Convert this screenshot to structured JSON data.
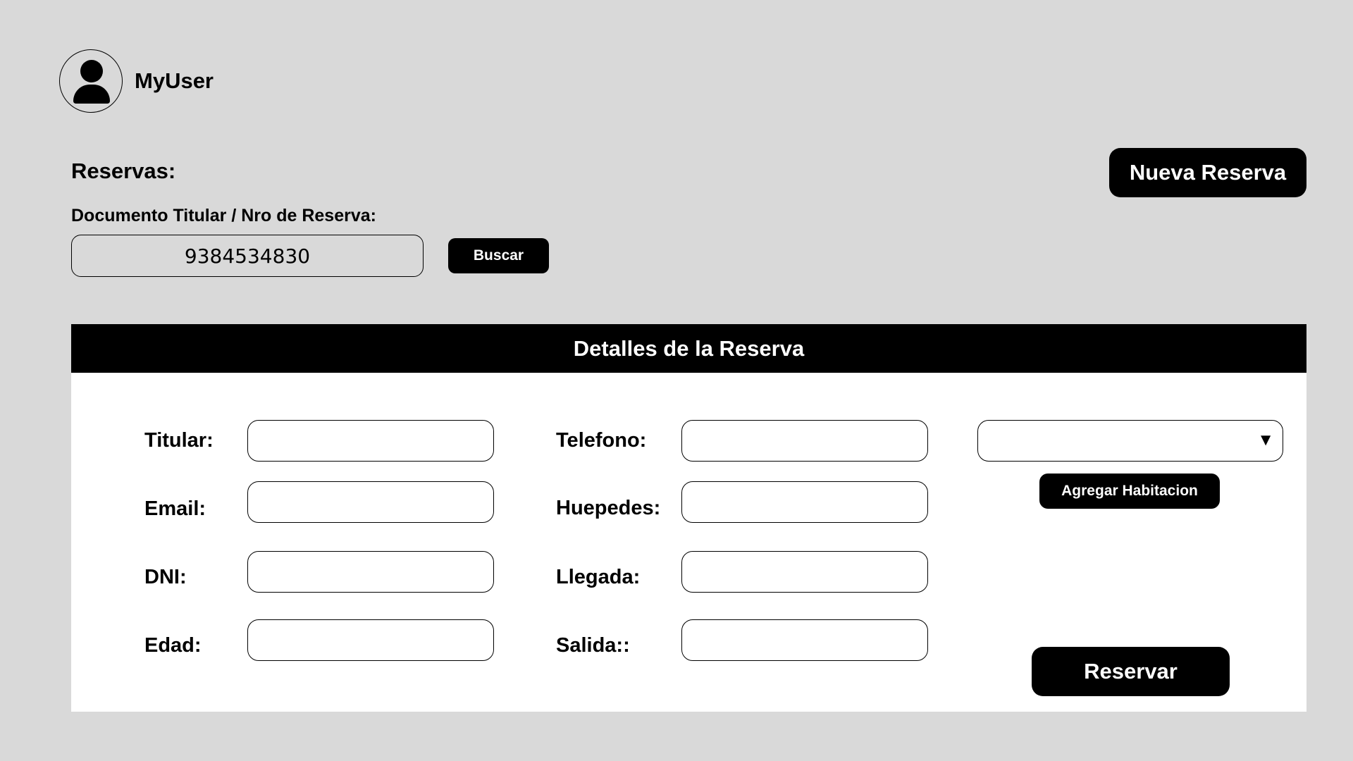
{
  "user": {
    "name": "MyUser",
    "avatar_icon": "user-icon"
  },
  "reservas": {
    "title": "Reservas:",
    "search_label": "Documento Titular / Nro de Reserva:",
    "search_value": "9384534830",
    "search_button": "Buscar",
    "new_button": "Nueva Reserva"
  },
  "details": {
    "title": "Detalles de la Reserva",
    "fields": {
      "titular": {
        "label": "Titular:",
        "value": ""
      },
      "email": {
        "label": "Email:",
        "value": ""
      },
      "dni": {
        "label": "DNI:",
        "value": ""
      },
      "edad": {
        "label": "Edad:",
        "value": ""
      },
      "telefono": {
        "label": "Telefono:",
        "value": ""
      },
      "huespedes": {
        "label": "Huepedes:",
        "value": ""
      },
      "llegada": {
        "label": "Llegada:",
        "value": ""
      },
      "salida": {
        "label": "Salida::",
        "value": ""
      }
    },
    "room_select": {
      "selected": "",
      "caret": "▼"
    },
    "add_room_button": "Agregar Habitacion",
    "submit_button": "Reservar"
  }
}
